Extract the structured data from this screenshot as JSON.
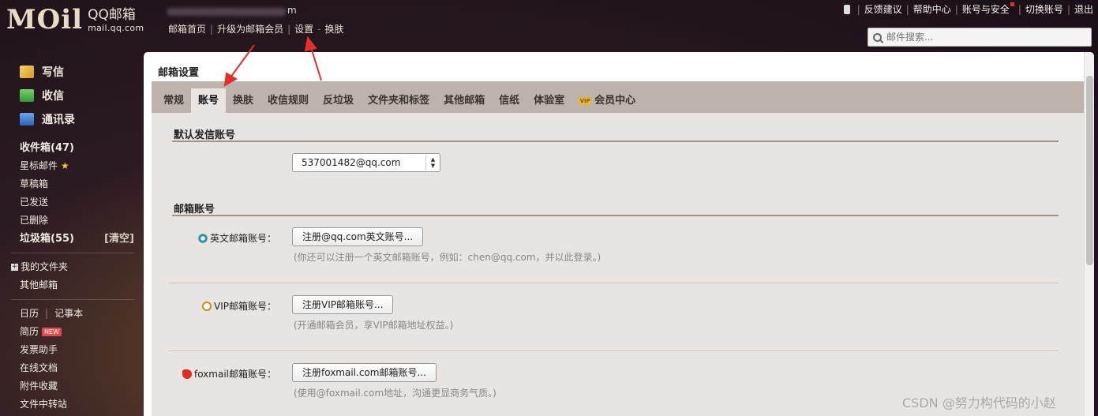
{
  "brand": {
    "logo_mark": "MOil",
    "name_cn": "QQ邮箱",
    "url": "mail.qq.com"
  },
  "user": {
    "visible_suffix": "m"
  },
  "top_nav": {
    "home": "邮箱首页",
    "upgrade": "升级为邮箱会员",
    "settings": "设置",
    "dash": "-",
    "skin": "换肤"
  },
  "top_right": {
    "feedback": "反馈建议",
    "help": "帮助中心",
    "account_security": "账号与安全",
    "switch_account": "切换账号",
    "logout": "退出"
  },
  "search": {
    "placeholder": "邮件搜索..."
  },
  "sidebar": {
    "write": "写信",
    "inbox": "收信",
    "contacts": "通讯录",
    "inbox_folder": "收件箱(47)",
    "starred": "星标邮件",
    "drafts": "草稿箱",
    "sent": "已发送",
    "deleted": "已删除",
    "spam": "垃圾箱(55)",
    "clear": "[清空]",
    "my_folders": "我的文件夹",
    "other_mailboxes": "其他邮箱",
    "calendar": "日历",
    "notebook": "记事本",
    "resume": "简历",
    "new_badge": "NEW",
    "invoice": "发票助手",
    "online_docs": "在线文档",
    "attachments": "附件收藏",
    "file_transfer": "文件中转站"
  },
  "main": {
    "title": "邮箱设置",
    "tabs": [
      "常规",
      "账号",
      "换肤",
      "收信规则",
      "反垃圾",
      "文件夹和标签",
      "其他邮箱",
      "信纸",
      "体验室",
      "会员中心"
    ],
    "vip_icon": "VIP",
    "default_sender": {
      "section_title": "默认发信账号",
      "selected": "537001482@qq.com"
    },
    "accounts": {
      "section_title": "邮箱账号",
      "english": {
        "label": "英文邮箱账号：",
        "button": "注册@qq.com英文账号...",
        "hint": "(你还可以注册一个英文邮箱账号，例如：chen@qq.com，并以此登录。)"
      },
      "vip": {
        "label": "VIP邮箱账号：",
        "button": "注册VIP邮箱账号...",
        "hint": "(开通邮箱会员，享VIP邮箱地址权益。)"
      },
      "foxmail": {
        "label": "foxmail邮箱账号：",
        "button": "注册foxmail.com邮箱账号...",
        "hint": "(使用@foxmail.com地址，沟通更显商务气质。)"
      }
    }
  },
  "watermark": "CSDN @努力构代码的小赵",
  "colors": {
    "tab_bar": "#bdb3ac",
    "content_bg": "#e8e4e1",
    "arrow": "#e0302a"
  }
}
